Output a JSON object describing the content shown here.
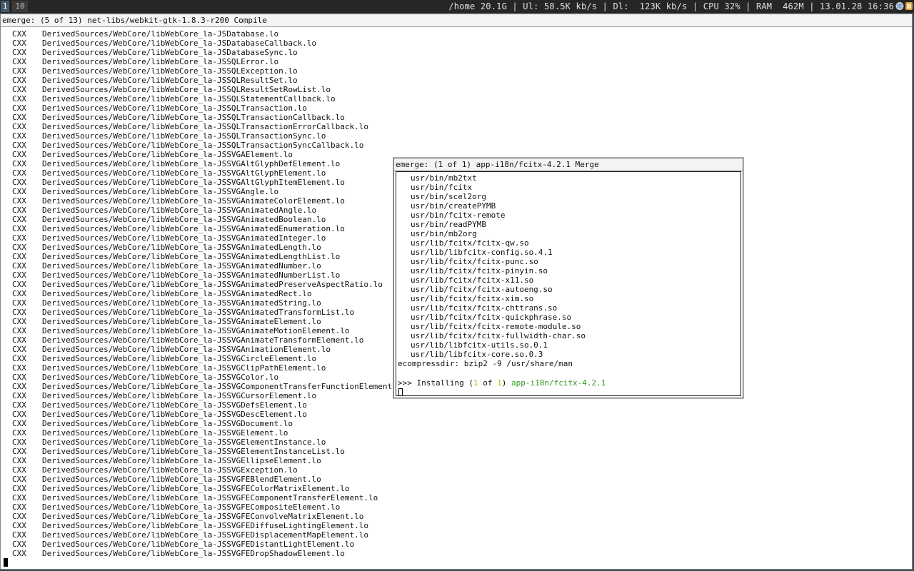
{
  "topbar": {
    "tags": [
      "1",
      "10"
    ],
    "status": "/home 20.1G | Ul: 58.5K kb/s | Dl:  123K kb/s | CPU 32% | RAM  462M | 13.01.28 16:36",
    "tray_icons": [
      "globe-icon",
      "app-icon"
    ],
    "colors": {
      "bar_bg": "#262626",
      "active_tag": "#44596a"
    }
  },
  "terminal": {
    "title": "emerge: (5 of 13) net-libs/webkit-gtk-1.8.3-r200 Compile",
    "lines": [
      {
        "cmd": "CXX",
        "path": "DerivedSources/WebCore/libWebCore_la-JSDatabase.lo"
      },
      {
        "cmd": "CXX",
        "path": "DerivedSources/WebCore/libWebCore_la-JSDatabaseCallback.lo"
      },
      {
        "cmd": "CXX",
        "path": "DerivedSources/WebCore/libWebCore_la-JSDatabaseSync.lo"
      },
      {
        "cmd": "CXX",
        "path": "DerivedSources/WebCore/libWebCore_la-JSSQLError.lo"
      },
      {
        "cmd": "CXX",
        "path": "DerivedSources/WebCore/libWebCore_la-JSSQLException.lo"
      },
      {
        "cmd": "CXX",
        "path": "DerivedSources/WebCore/libWebCore_la-JSSQLResultSet.lo"
      },
      {
        "cmd": "CXX",
        "path": "DerivedSources/WebCore/libWebCore_la-JSSQLResultSetRowList.lo"
      },
      {
        "cmd": "CXX",
        "path": "DerivedSources/WebCore/libWebCore_la-JSSQLStatementCallback.lo"
      },
      {
        "cmd": "CXX",
        "path": "DerivedSources/WebCore/libWebCore_la-JSSQLTransaction.lo"
      },
      {
        "cmd": "CXX",
        "path": "DerivedSources/WebCore/libWebCore_la-JSSQLTransactionCallback.lo"
      },
      {
        "cmd": "CXX",
        "path": "DerivedSources/WebCore/libWebCore_la-JSSQLTransactionErrorCallback.lo"
      },
      {
        "cmd": "CXX",
        "path": "DerivedSources/WebCore/libWebCore_la-JSSQLTransactionSync.lo"
      },
      {
        "cmd": "CXX",
        "path": "DerivedSources/WebCore/libWebCore_la-JSSQLTransactionSyncCallback.lo"
      },
      {
        "cmd": "CXX",
        "path": "DerivedSources/WebCore/libWebCore_la-JSSVGAElement.lo"
      },
      {
        "cmd": "CXX",
        "path": "DerivedSources/WebCore/libWebCore_la-JSSVGAltGlyphDefElement.lo"
      },
      {
        "cmd": "CXX",
        "path": "DerivedSources/WebCore/libWebCore_la-JSSVGAltGlyphElement.lo"
      },
      {
        "cmd": "CXX",
        "path": "DerivedSources/WebCore/libWebCore_la-JSSVGAltGlyphItemElement.lo"
      },
      {
        "cmd": "CXX",
        "path": "DerivedSources/WebCore/libWebCore_la-JSSVGAngle.lo"
      },
      {
        "cmd": "CXX",
        "path": "DerivedSources/WebCore/libWebCore_la-JSSVGAnimateColorElement.lo"
      },
      {
        "cmd": "CXX",
        "path": "DerivedSources/WebCore/libWebCore_la-JSSVGAnimatedAngle.lo"
      },
      {
        "cmd": "CXX",
        "path": "DerivedSources/WebCore/libWebCore_la-JSSVGAnimatedBoolean.lo"
      },
      {
        "cmd": "CXX",
        "path": "DerivedSources/WebCore/libWebCore_la-JSSVGAnimatedEnumeration.lo"
      },
      {
        "cmd": "CXX",
        "path": "DerivedSources/WebCore/libWebCore_la-JSSVGAnimatedInteger.lo"
      },
      {
        "cmd": "CXX",
        "path": "DerivedSources/WebCore/libWebCore_la-JSSVGAnimatedLength.lo"
      },
      {
        "cmd": "CXX",
        "path": "DerivedSources/WebCore/libWebCore_la-JSSVGAnimatedLengthList.lo"
      },
      {
        "cmd": "CXX",
        "path": "DerivedSources/WebCore/libWebCore_la-JSSVGAnimatedNumber.lo"
      },
      {
        "cmd": "CXX",
        "path": "DerivedSources/WebCore/libWebCore_la-JSSVGAnimatedNumberList.lo"
      },
      {
        "cmd": "CXX",
        "path": "DerivedSources/WebCore/libWebCore_la-JSSVGAnimatedPreserveAspectRatio.lo"
      },
      {
        "cmd": "CXX",
        "path": "DerivedSources/WebCore/libWebCore_la-JSSVGAnimatedRect.lo"
      },
      {
        "cmd": "CXX",
        "path": "DerivedSources/WebCore/libWebCore_la-JSSVGAnimatedString.lo"
      },
      {
        "cmd": "CXX",
        "path": "DerivedSources/WebCore/libWebCore_la-JSSVGAnimatedTransformList.lo"
      },
      {
        "cmd": "CXX",
        "path": "DerivedSources/WebCore/libWebCore_la-JSSVGAnimateElement.lo"
      },
      {
        "cmd": "CXX",
        "path": "DerivedSources/WebCore/libWebCore_la-JSSVGAnimateMotionElement.lo"
      },
      {
        "cmd": "CXX",
        "path": "DerivedSources/WebCore/libWebCore_la-JSSVGAnimateTransformElement.lo"
      },
      {
        "cmd": "CXX",
        "path": "DerivedSources/WebCore/libWebCore_la-JSSVGAnimationElement.lo"
      },
      {
        "cmd": "CXX",
        "path": "DerivedSources/WebCore/libWebCore_la-JSSVGCircleElement.lo"
      },
      {
        "cmd": "CXX",
        "path": "DerivedSources/WebCore/libWebCore_la-JSSVGClipPathElement.lo"
      },
      {
        "cmd": "CXX",
        "path": "DerivedSources/WebCore/libWebCore_la-JSSVGColor.lo"
      },
      {
        "cmd": "CXX",
        "path": "DerivedSources/WebCore/libWebCore_la-JSSVGComponentTransferFunctionElement.lo"
      },
      {
        "cmd": "CXX",
        "path": "DerivedSources/WebCore/libWebCore_la-JSSVGCursorElement.lo"
      },
      {
        "cmd": "CXX",
        "path": "DerivedSources/WebCore/libWebCore_la-JSSVGDefsElement.lo"
      },
      {
        "cmd": "CXX",
        "path": "DerivedSources/WebCore/libWebCore_la-JSSVGDescElement.lo"
      },
      {
        "cmd": "CXX",
        "path": "DerivedSources/WebCore/libWebCore_la-JSSVGDocument.lo"
      },
      {
        "cmd": "CXX",
        "path": "DerivedSources/WebCore/libWebCore_la-JSSVGElement.lo"
      },
      {
        "cmd": "CXX",
        "path": "DerivedSources/WebCore/libWebCore_la-JSSVGElementInstance.lo"
      },
      {
        "cmd": "CXX",
        "path": "DerivedSources/WebCore/libWebCore_la-JSSVGElementInstanceList.lo"
      },
      {
        "cmd": "CXX",
        "path": "DerivedSources/WebCore/libWebCore_la-JSSVGEllipseElement.lo"
      },
      {
        "cmd": "CXX",
        "path": "DerivedSources/WebCore/libWebCore_la-JSSVGException.lo"
      },
      {
        "cmd": "CXX",
        "path": "DerivedSources/WebCore/libWebCore_la-JSSVGFEBlendElement.lo"
      },
      {
        "cmd": "CXX",
        "path": "DerivedSources/WebCore/libWebCore_la-JSSVGFEColorMatrixElement.lo"
      },
      {
        "cmd": "CXX",
        "path": "DerivedSources/WebCore/libWebCore_la-JSSVGFEComponentTransferElement.lo"
      },
      {
        "cmd": "CXX",
        "path": "DerivedSources/WebCore/libWebCore_la-JSSVGFECompositeElement.lo"
      },
      {
        "cmd": "CXX",
        "path": "DerivedSources/WebCore/libWebCore_la-JSSVGFEConvolveMatrixElement.lo"
      },
      {
        "cmd": "CXX",
        "path": "DerivedSources/WebCore/libWebCore_la-JSSVGFEDiffuseLightingElement.lo"
      },
      {
        "cmd": "CXX",
        "path": "DerivedSources/WebCore/libWebCore_la-JSSVGFEDisplacementMapElement.lo"
      },
      {
        "cmd": "CXX",
        "path": "DerivedSources/WebCore/libWebCore_la-JSSVGFEDistantLightElement.lo"
      },
      {
        "cmd": "CXX",
        "path": "DerivedSources/WebCore/libWebCore_la-JSSVGFEDropShadowElement.lo"
      }
    ]
  },
  "popup": {
    "title": "emerge: (1 of 1) app-i18n/fcitx-4.2.1 Merge",
    "files": [
      "usr/bin/mb2txt",
      "usr/bin/fcitx",
      "usr/bin/scel2org",
      "usr/bin/createPYMB",
      "usr/bin/fcitx-remote",
      "usr/bin/readPYMB",
      "usr/bin/mb2org",
      "usr/lib/fcitx/fcitx-qw.so",
      "usr/lib/libfcitx-config.so.4.1",
      "usr/lib/fcitx/fcitx-punc.so",
      "usr/lib/fcitx/fcitx-pinyin.so",
      "usr/lib/fcitx/fcitx-x11.so",
      "usr/lib/fcitx/fcitx-autoeng.so",
      "usr/lib/fcitx/fcitx-xim.so",
      "usr/lib/fcitx/fcitx-chttrans.so",
      "usr/lib/fcitx/fcitx-quickphrase.so",
      "usr/lib/fcitx/fcitx-remote-module.so",
      "usr/lib/fcitx/fcitx-fullwidth-char.so",
      "usr/lib/libfcitx-utils.so.0.1",
      "usr/lib/libfcitx-core.so.0.3"
    ],
    "ecompress": "ecompressdir: bzip2 -9 /usr/share/man",
    "install": {
      "prefix": ">>> Installing (",
      "current": "1",
      "of": " of ",
      "total": "1",
      "close": ") ",
      "package": "app-i18n/fcitx-4.2.1"
    },
    "colors": {
      "count": "#c8b400",
      "package": "#2e9a1c"
    }
  }
}
